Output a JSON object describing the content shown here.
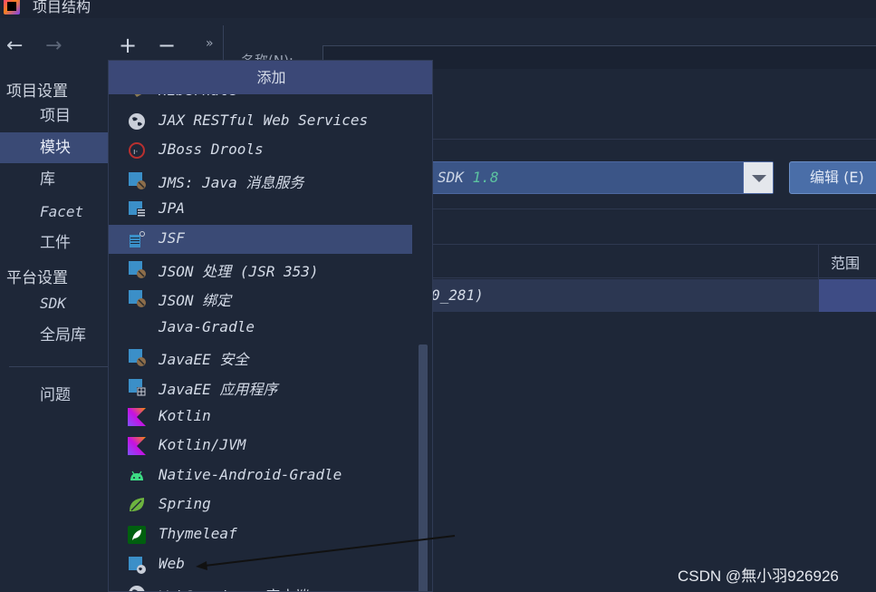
{
  "window": {
    "title": "项目结构"
  },
  "nav": {
    "back": "←",
    "forward": "→"
  },
  "sidebar": {
    "project_settings": "项目设置",
    "items_project": [
      {
        "label": "项目"
      },
      {
        "label": "模块"
      },
      {
        "label": "库"
      },
      {
        "label": "Facet"
      },
      {
        "label": "工件"
      }
    ],
    "platform_settings": "平台设置",
    "items_platform": [
      {
        "label": "SDK"
      },
      {
        "label": "全局库"
      }
    ],
    "problems": "问题"
  },
  "toolbar": {
    "add": "+",
    "remove": "−",
    "more": "»"
  },
  "main": {
    "name_label": "名称(N):",
    "sdk_label": "SDK",
    "sdk_version": "1.8",
    "edit_button": "编辑 (E)",
    "scope_header": "范围",
    "row_text": "0_281)"
  },
  "popup": {
    "title": "添加",
    "items": [
      {
        "label": "Hibernate",
        "icon": "hibernate-icon"
      },
      {
        "label": "JAX RESTful Web Services",
        "icon": "globe-icon"
      },
      {
        "label": "JBoss Drools",
        "icon": "jboss-icon"
      },
      {
        "label": "JMS: Java 消息服务",
        "icon": "module-icon"
      },
      {
        "label": "JPA",
        "icon": "jpa-icon"
      },
      {
        "label": "JSF",
        "icon": "jsf-icon"
      },
      {
        "label": "JSON 处理 (JSR 353)",
        "icon": "module-icon"
      },
      {
        "label": "JSON 绑定",
        "icon": "module-icon"
      },
      {
        "label": "Java-Gradle",
        "icon": "none"
      },
      {
        "label": "JavaEE 安全",
        "icon": "module-icon"
      },
      {
        "label": "JavaEE 应用程序",
        "icon": "javaee-app-icon"
      },
      {
        "label": "Kotlin",
        "icon": "kotlin-icon"
      },
      {
        "label": "Kotlin/JVM",
        "icon": "kotlin-icon"
      },
      {
        "label": "Native-Android-Gradle",
        "icon": "android-icon"
      },
      {
        "label": "Spring",
        "icon": "spring-icon"
      },
      {
        "label": "Thymeleaf",
        "icon": "thymeleaf-icon"
      },
      {
        "label": "Web",
        "icon": "web-icon"
      },
      {
        "label": "WebServices 客户端",
        "icon": "globe-icon"
      }
    ],
    "selected_index": 5
  },
  "colors": {
    "background": "#1e2738",
    "selection": "#3a4a75",
    "accent": "#4a6ea8"
  },
  "watermark": "CSDN @無小羽926926"
}
